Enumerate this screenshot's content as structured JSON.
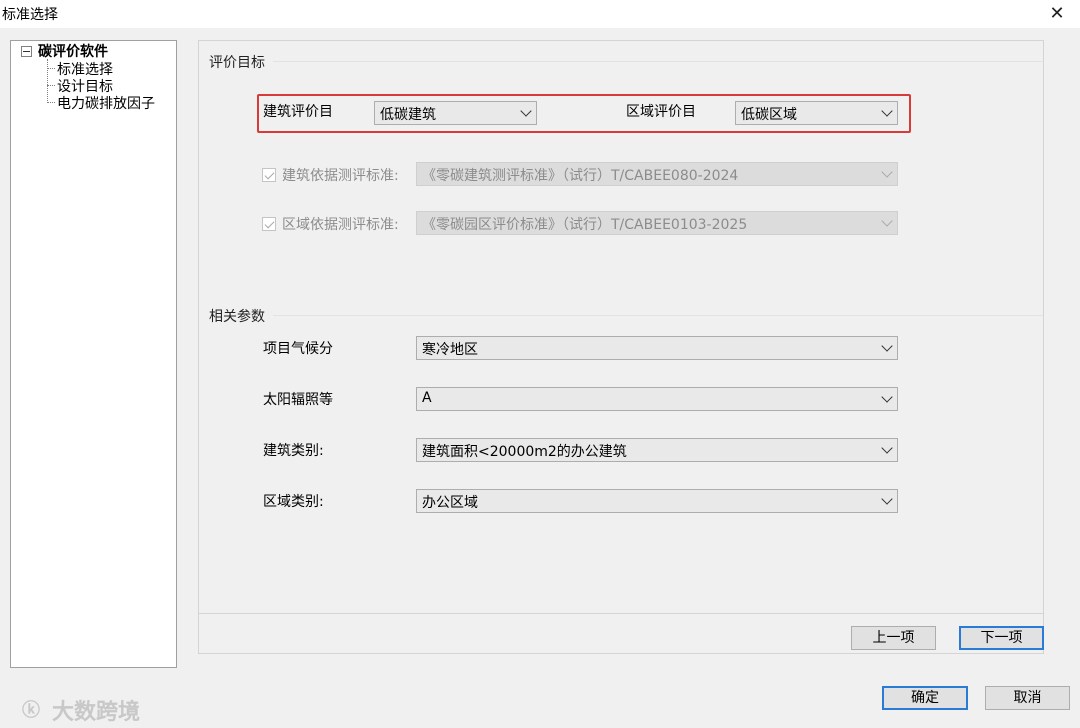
{
  "window": {
    "title": "标准选择",
    "close_glyph": "✕"
  },
  "tree": {
    "root": "碳评价软件",
    "items": [
      {
        "label": "标准选择"
      },
      {
        "label": "设计目标"
      },
      {
        "label": "电力碳排放因子"
      }
    ]
  },
  "eval_target": {
    "section_title": "评价目标",
    "building_label": "建筑评价目",
    "building_value": "低碳建筑",
    "region_label": "区域评价目",
    "region_value": "低碳区域",
    "building_standard_label": "建筑依据测评标准:",
    "building_standard_value": "《零碳建筑测评标准》（试行）T/CABEE080-2024",
    "region_standard_label": "区域依据测评标准:",
    "region_standard_value": "《零碳园区评价标准》（试行）T/CABEE0103-2025"
  },
  "params": {
    "section_title": "相关参数",
    "climate_label": "项目气候分",
    "climate_value": "寒冷地区",
    "solar_label": "太阳辐照等",
    "solar_value": "A",
    "building_type_label": "建筑类别:",
    "building_type_value": "建筑面积<20000m2的办公建筑",
    "region_type_label": "区域类别:",
    "region_type_value": "办公区域"
  },
  "nav": {
    "prev_label": "上一项",
    "next_label": "下一项"
  },
  "footer": {
    "ok_label": "确定",
    "cancel_label": "取消"
  },
  "watermark": {
    "logo": "ⓚ",
    "text": "大数跨境"
  },
  "colors": {
    "highlight": "#d83a3a",
    "default_button_border": "#2a7bd6"
  }
}
